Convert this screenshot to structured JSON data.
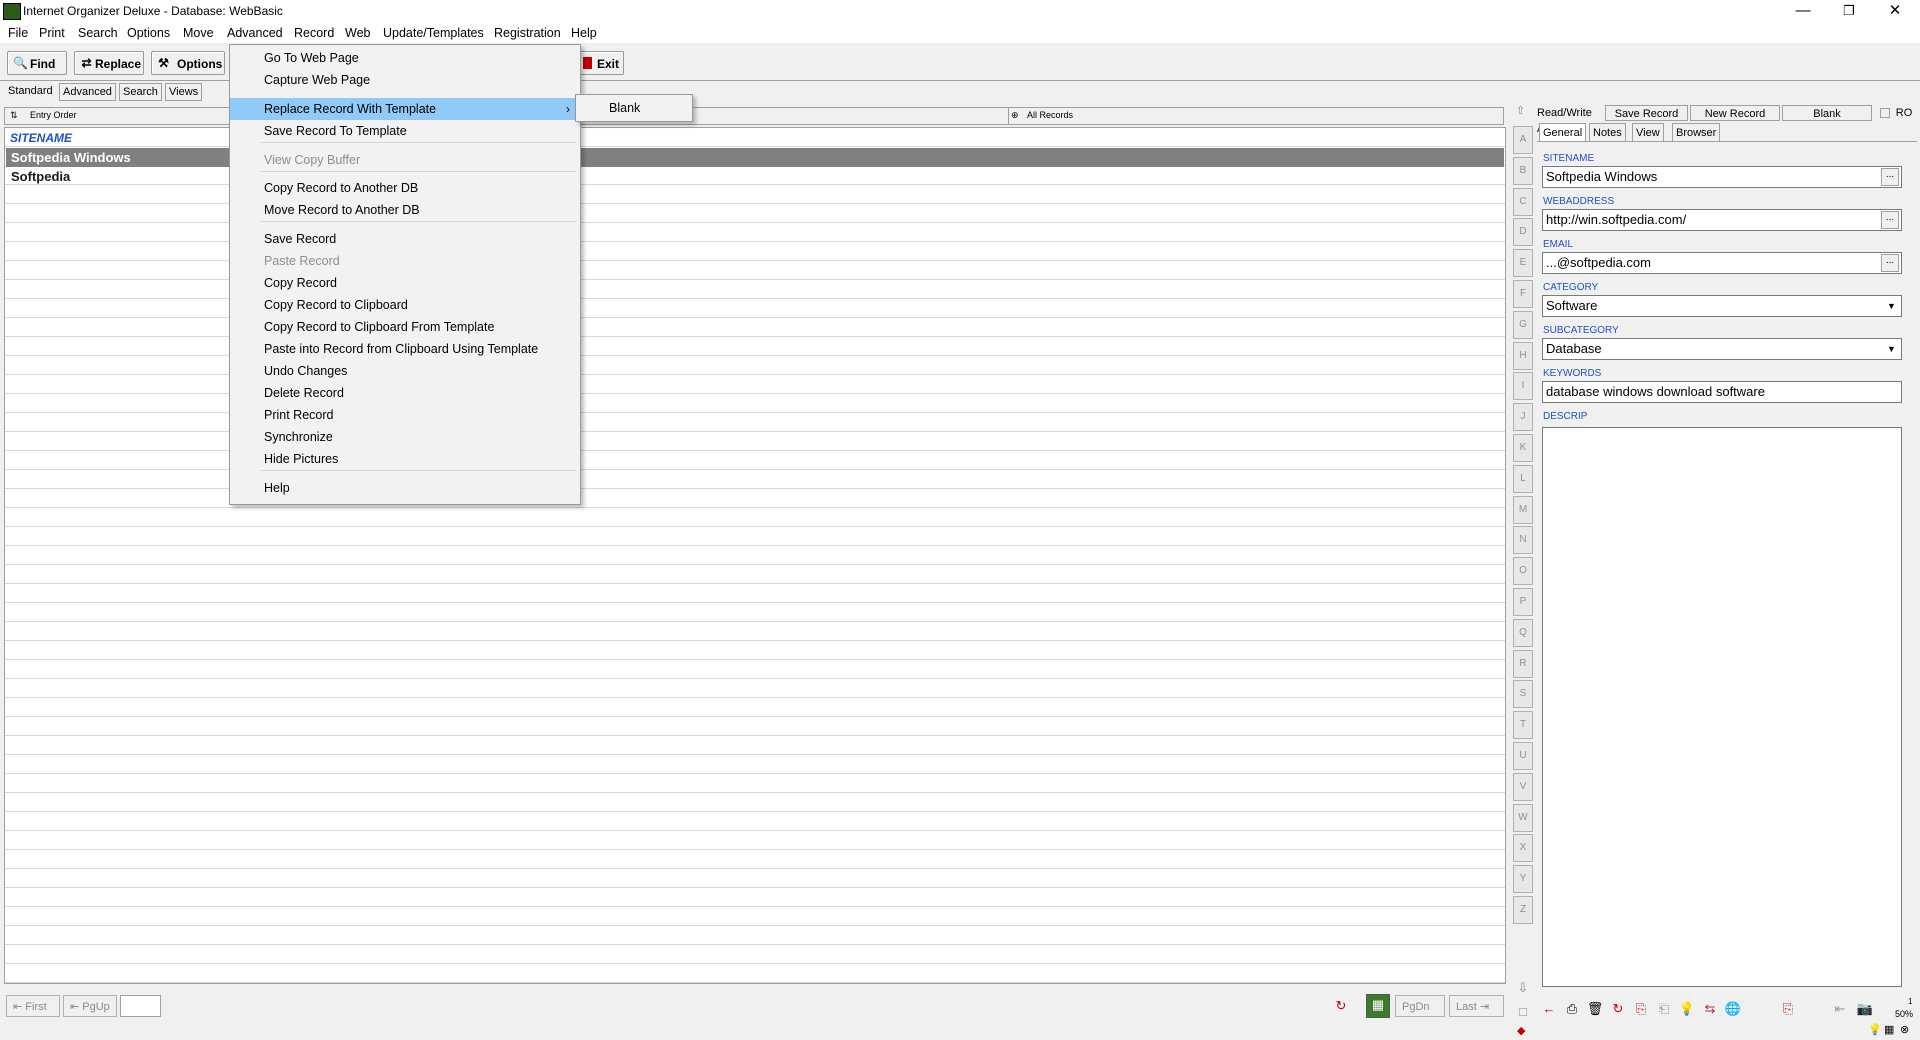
{
  "window": {
    "title": "Internet Organizer Deluxe - Database: WebBasic",
    "minimize": "—",
    "restore": "❐",
    "close": "✕"
  },
  "menubar": [
    "File",
    "Print",
    "Search",
    "Options",
    "Move",
    "Advanced",
    "Record",
    "Web",
    "Update/Templates",
    "Registration",
    "Help"
  ],
  "toolbar": {
    "find": "Find",
    "replace": "Replace",
    "options": "Options",
    "exit": "Exit"
  },
  "left_tabs": [
    "Standard",
    "Advanced",
    "Search",
    "Views"
  ],
  "list": {
    "sort_label": "Entry Order",
    "filter_label": "All Records",
    "column": "SITENAME",
    "rows": [
      "Softpedia Windows",
      "Softpedia"
    ]
  },
  "menu": {
    "items": [
      {
        "label": "Go To Web Page",
        "enabled": true
      },
      {
        "label": "Capture Web Page",
        "enabled": true
      },
      {
        "label": "Replace Record With Template",
        "enabled": true,
        "submenu": true,
        "highlight": true
      },
      {
        "label": "Save Record To Template",
        "enabled": true
      },
      {
        "label": "View Copy Buffer",
        "enabled": false
      },
      {
        "label": "Copy Record to Another DB",
        "enabled": true
      },
      {
        "label": "Move Record to Another DB",
        "enabled": true
      },
      {
        "label": "Save Record",
        "enabled": true
      },
      {
        "label": "Paste Record",
        "enabled": false
      },
      {
        "label": "Copy Record",
        "enabled": true
      },
      {
        "label": "Copy Record to Clipboard",
        "enabled": true
      },
      {
        "label": "Copy Record to Clipboard From Template",
        "enabled": true
      },
      {
        "label": "Paste into Record from Clipboard Using Template",
        "enabled": true
      },
      {
        "label": "Undo Changes",
        "enabled": true
      },
      {
        "label": "Delete Record",
        "enabled": true
      },
      {
        "label": "Print Record",
        "enabled": true
      },
      {
        "label": "Synchronize",
        "enabled": true
      },
      {
        "label": "Hide Pictures",
        "enabled": true
      },
      {
        "label": "Help",
        "enabled": true
      }
    ],
    "submenu_items": [
      "Blank"
    ],
    "submenu_arrow": "›"
  },
  "alphabet": [
    "A",
    "B",
    "C",
    "D",
    "E",
    "F",
    "G",
    "H",
    "I",
    "J",
    "K",
    "L",
    "M",
    "N",
    "O",
    "P",
    "Q",
    "R",
    "S",
    "T",
    "U",
    "V",
    "W",
    "X",
    "Y",
    "Z"
  ],
  "record_panel": {
    "access": "Read/Write Acce",
    "save": "Save Record",
    "new": "New Record",
    "blank": "Blank",
    "ro": "RO",
    "tabs": [
      "General",
      "Notes",
      "View",
      "Browser"
    ],
    "fields": {
      "sitename_label": "SITENAME",
      "sitename": "Softpedia Windows",
      "webaddress_label": "WEBADDRESS",
      "webaddress": "http://win.softpedia.com/",
      "email_label": "EMAIL",
      "email": "...@softpedia.com",
      "category_label": "CATEGORY",
      "category": "Software",
      "subcategory_label": "SUBCATEGORY",
      "subcategory": "Database",
      "keywords_label": "KEYWORDS",
      "keywords": "database windows download software",
      "descrip_label": "DESCRIP"
    },
    "ellipsis": "...",
    "zoom_top": "1",
    "zoom": "50%"
  },
  "bottom": {
    "first": "First",
    "pgup": "PgUp",
    "pgdn": "PgDn",
    "last": "Last"
  },
  "colors": {
    "highlight": "#91c9f7",
    "selected_row": "#808080",
    "label_blue": "#2050c8"
  }
}
